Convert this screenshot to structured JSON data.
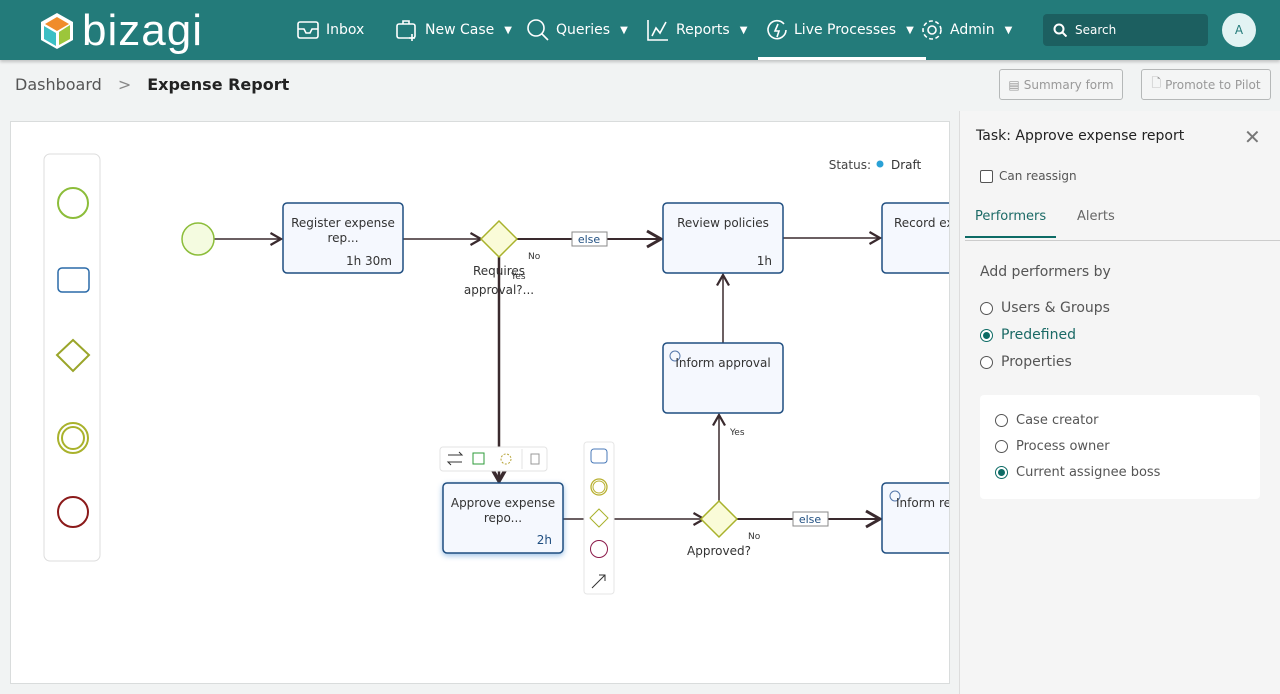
{
  "header": {
    "logo": "bizagi",
    "nav": [
      {
        "label": "Inbox",
        "icon": "inbox-icon"
      },
      {
        "label": "New Case",
        "icon": "new-case-icon"
      },
      {
        "label": "Queries",
        "icon": "search-icon"
      },
      {
        "label": "Reports",
        "icon": "chart-icon"
      },
      {
        "label": "Live Processes",
        "icon": "live-process-icon",
        "active": true
      },
      {
        "label": "Admin",
        "icon": "gear-icon"
      }
    ],
    "search_placeholder": "Search",
    "avatar": "A"
  },
  "breadcrumb": {
    "parent": "Dashboard",
    "current": "Expense Report"
  },
  "toolbar": {
    "summary": "Summary form",
    "promote": "Promote to Pilot"
  },
  "diagram": {
    "status_label": "Status:",
    "status": "Draft",
    "status_color": "#2aa1d6",
    "tasks": {
      "register": {
        "l1": "Register expense",
        "l2": "rep...",
        "time": "1h 30m"
      },
      "review": {
        "l1": "Review policies",
        "time": "1h"
      },
      "record": {
        "l1": "Record ex"
      },
      "inform_approval": {
        "l1": "Inform approval"
      },
      "approve": {
        "l1": "Approve expense",
        "l2": "repo...",
        "time": "2h"
      },
      "inform_re": {
        "l1": "Inform re"
      }
    },
    "gateways": {
      "requires": {
        "l1": "Requires",
        "l2": "approval?..."
      },
      "approved": {
        "l1": "Approved?"
      }
    },
    "labels": {
      "no": "No",
      "yes": "Yes",
      "else": "else"
    }
  },
  "panel": {
    "title": "Task: Approve expense report",
    "can_reassign": "Can reassign",
    "can_reassign_checked": false,
    "tabs": [
      "Performers",
      "Alerts"
    ],
    "active_tab": "Performers",
    "add_by": "Add performers by",
    "options": [
      {
        "label": "Users & Groups",
        "selected": false
      },
      {
        "label": "Predefined",
        "selected": true
      },
      {
        "label": "Properties",
        "selected": false
      }
    ],
    "predefined": [
      {
        "label": "Case creator",
        "selected": false
      },
      {
        "label": "Process owner",
        "selected": false
      },
      {
        "label": "Current assignee boss",
        "selected": true
      }
    ]
  }
}
